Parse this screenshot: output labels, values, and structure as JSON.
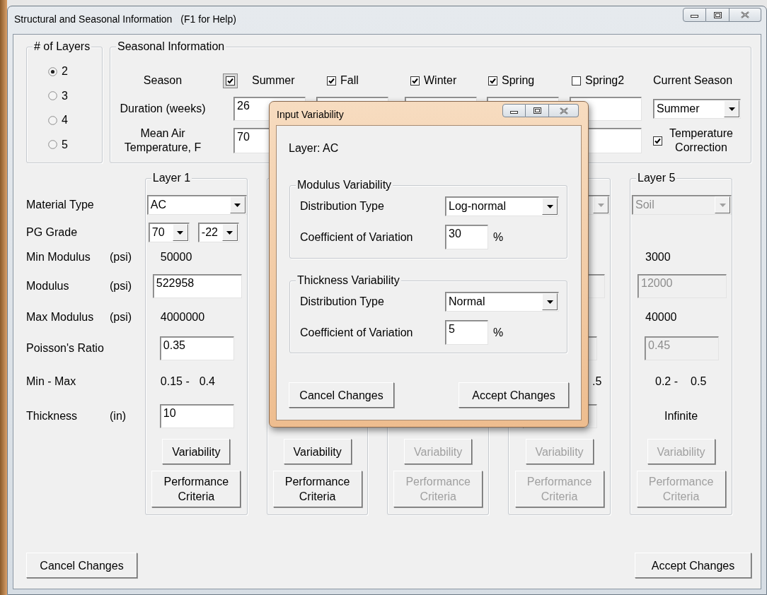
{
  "window": {
    "title": "Structural and Seasonal Information",
    "help_hint": "(F1 for Help)"
  },
  "layer_count": {
    "title": "# of Layers",
    "options": [
      {
        "label": "2",
        "selected": true
      },
      {
        "label": "3",
        "selected": false
      },
      {
        "label": "4",
        "selected": false
      },
      {
        "label": "5",
        "selected": false
      }
    ]
  },
  "seasonal": {
    "title": "Seasonal Information",
    "season_label": "Season",
    "duration_label": "Duration (weeks)",
    "temperature_label": "Mean Air Temperature, F",
    "seasons": [
      {
        "name": "Summer",
        "checked": true,
        "focused": true,
        "duration": "26",
        "temperature": "70"
      },
      {
        "name": "Fall",
        "checked": true,
        "focused": false
      },
      {
        "name": "Winter",
        "checked": true,
        "focused": false
      },
      {
        "name": "Spring",
        "checked": true,
        "focused": false
      },
      {
        "name": "Spring2",
        "checked": false,
        "focused": false
      }
    ],
    "current_season": {
      "label": "Current Season",
      "value": "Summer"
    },
    "temperature_correction": {
      "label": "Temperature Correction",
      "checked": true
    }
  },
  "properties": [
    {
      "label": "Material Type"
    },
    {
      "label": "PG Grade"
    },
    {
      "label": "Min Modulus",
      "unit": "(psi)"
    },
    {
      "label": "Modulus",
      "unit": "(psi)"
    },
    {
      "label": "Max Modulus",
      "unit": "(psi)"
    },
    {
      "label": "Poisson's Ratio"
    },
    {
      "label": "Min - Max"
    },
    {
      "label": "Thickness",
      "unit": "(in)"
    }
  ],
  "layers": [
    {
      "kind": "full",
      "title": "Layer 1",
      "disabled": false,
      "material": "AC",
      "pg_grade": [
        "70",
        "-22"
      ],
      "min_modulus": "50000",
      "modulus": "522958",
      "max_modulus": "4000000",
      "poisson": "0.35",
      "min_max": [
        "0.15 -",
        "0.4"
      ],
      "thickness": "10",
      "variability": "Variability",
      "performance": "Performance Criteria"
    },
    {
      "kind": "covered",
      "disabled": false,
      "variability": "Variability",
      "performance": "Performance Criteria"
    },
    {
      "kind": "covered",
      "disabled": true,
      "variability": "Variability",
      "performance": "Performance Criteria"
    },
    {
      "kind": "edge",
      "disabled": true,
      "min_max": [
        ".5"
      ],
      "variability": "Variability",
      "performance": "Performance Criteria"
    },
    {
      "kind": "full",
      "title": "Layer 5",
      "disabled": true,
      "material": "Soil",
      "min_modulus": "3000",
      "modulus": "12000",
      "max_modulus": "40000",
      "poisson": "0.45",
      "min_max": [
        "0.2 -",
        "0.5"
      ],
      "thickness_text": "Infinite",
      "variability": "Variability",
      "performance": "Performance Criteria"
    }
  ],
  "buttons": [
    "Cancel Changes",
    "Accept Changes"
  ],
  "dialog": {
    "title": "Input Variability",
    "layer_label": "Layer: AC",
    "groups": [
      {
        "title": "Modulus Variability",
        "distribution_label": "Distribution Type",
        "distribution": "Log-normal",
        "cov_label": "Coefficient of Variation",
        "cov": "30",
        "unit": "%"
      },
      {
        "title": "Thickness Variability",
        "distribution_label": "Distribution Type",
        "distribution": "Normal",
        "cov_label": "Coefficient of Variation",
        "cov": "5",
        "unit": "%"
      }
    ],
    "buttons": [
      "Cancel Changes",
      "Accept Changes"
    ]
  }
}
